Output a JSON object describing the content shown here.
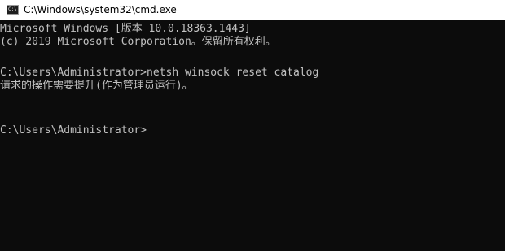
{
  "window": {
    "title": "C:\\Windows\\system32\\cmd.exe",
    "icon": "cmd-icon"
  },
  "console": {
    "lines": [
      "Microsoft Windows [版本 10.0.18363.1443]",
      "(c) 2019 Microsoft Corporation。保留所有权利。",
      "C:\\Users\\Administrator>netsh winsock reset catalog",
      "请求的操作需要提升(作为管理员运行)。",
      "C:\\Users\\Administrator>"
    ]
  },
  "colors": {
    "console_background": "#0c0c0c",
    "console_text": "#c0c0c0",
    "titlebar_background": "#ffffff"
  }
}
